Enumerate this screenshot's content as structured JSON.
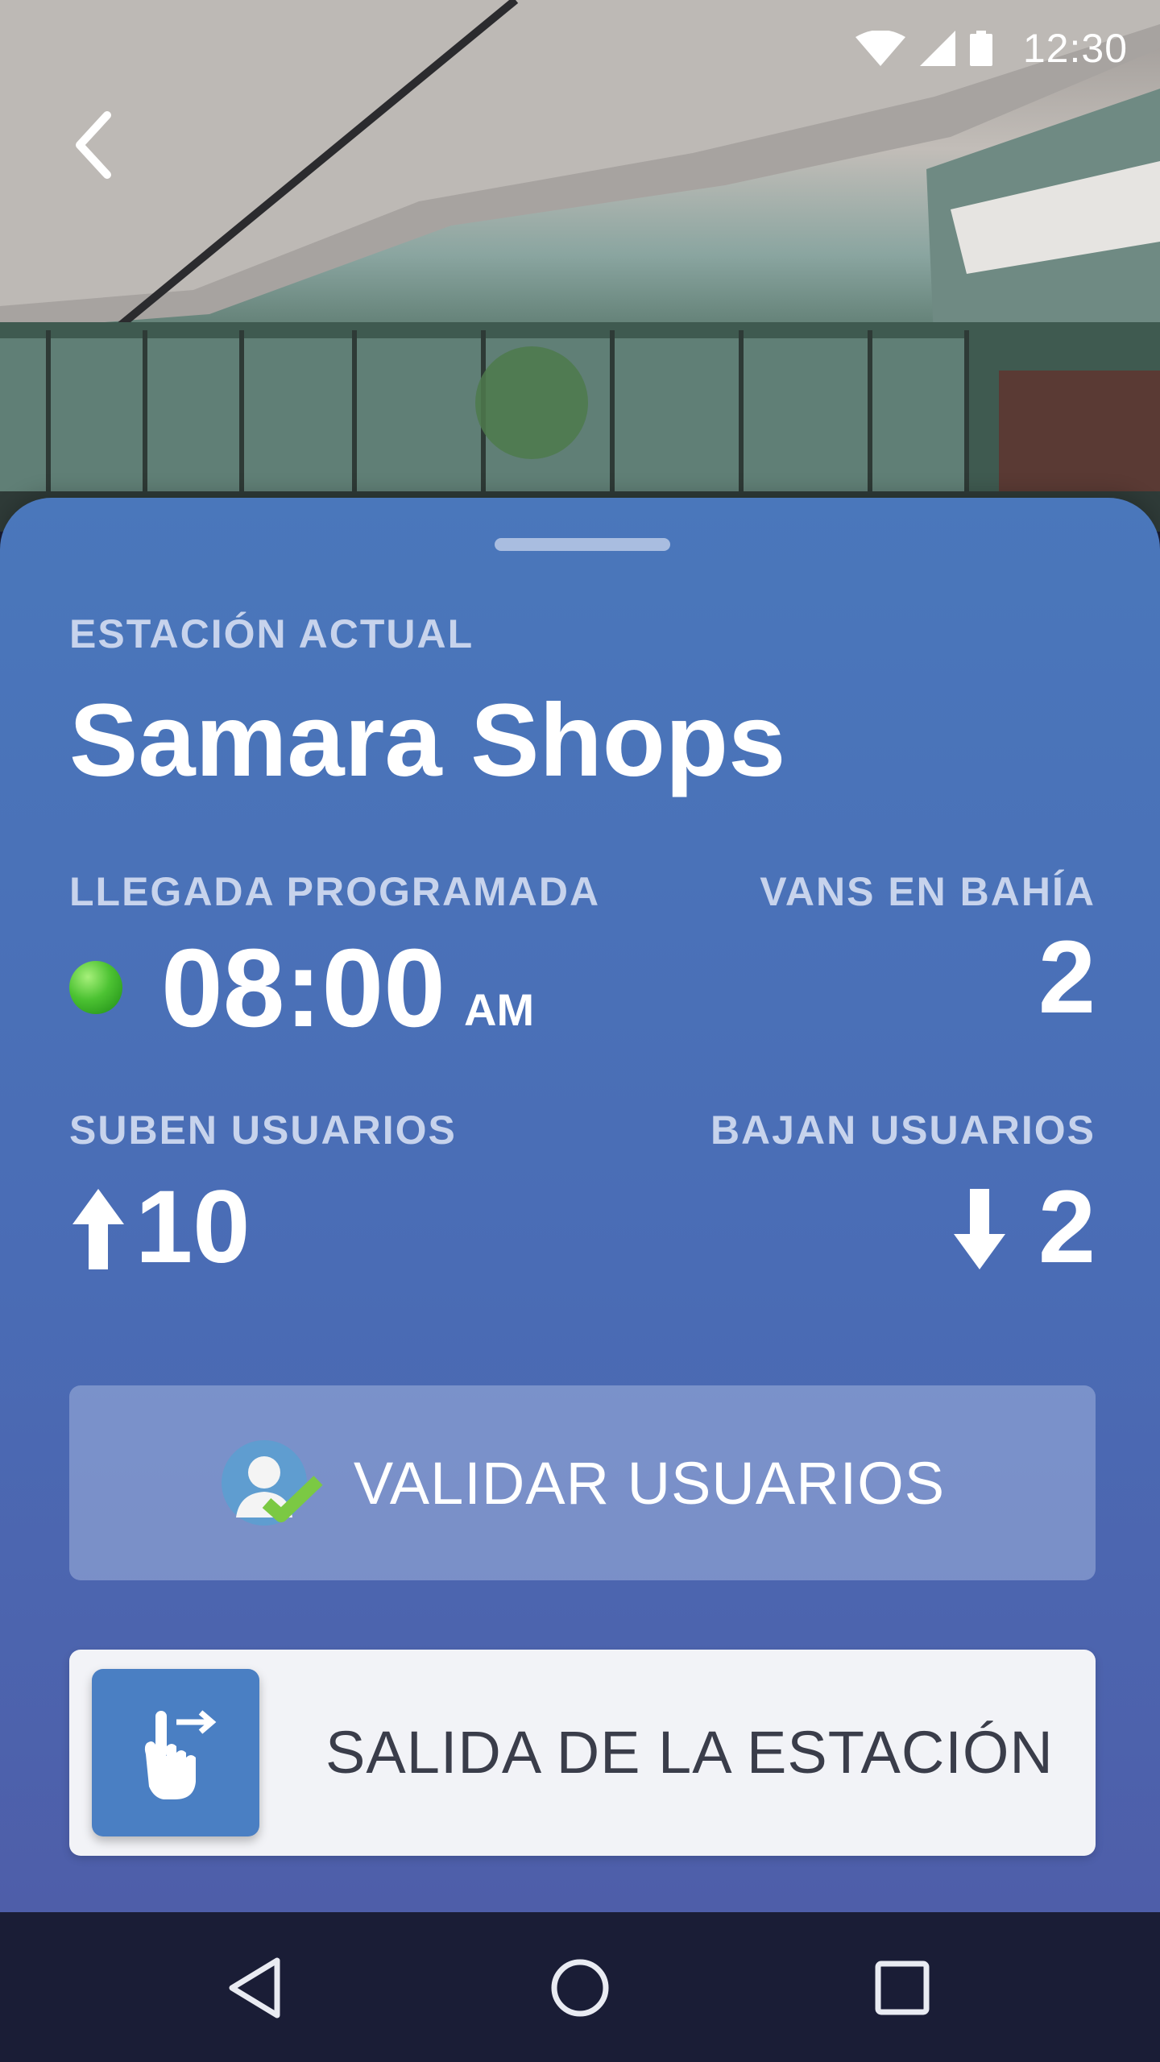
{
  "status_bar": {
    "time": "12:30"
  },
  "header": {
    "back_icon": "chevron-left-icon"
  },
  "station": {
    "section_label": "ESTACIÓN ACTUAL",
    "name": "Samara Shops"
  },
  "arrival": {
    "label": "LLEGADA PROGRAMADA",
    "time": "08:00",
    "ampm": "AM",
    "status_color": "#43b82c"
  },
  "vans": {
    "label": "VANS EN BAHÍA",
    "value": "2"
  },
  "boarding": {
    "label": "SUBEN USUARIOS",
    "value": "10",
    "icon": "arrow-up-icon"
  },
  "alighting": {
    "label": "BAJAN USUARIOS",
    "value": "2",
    "icon": "arrow-down-icon"
  },
  "actions": {
    "validate_label": "VALIDAR USUARIOS",
    "validate_icon": "user-check-icon",
    "exit_label": "SALIDA DE LA ESTACIÓN",
    "exit_icon": "hand-swipe-icon"
  },
  "nav": {
    "back": "nav-back-icon",
    "home": "nav-home-icon",
    "recents": "nav-recents-icon"
  },
  "colors": {
    "sheet_top": "#4a77bb",
    "sheet_bottom": "#4e5ea9",
    "navbar": "#1a1d36"
  }
}
